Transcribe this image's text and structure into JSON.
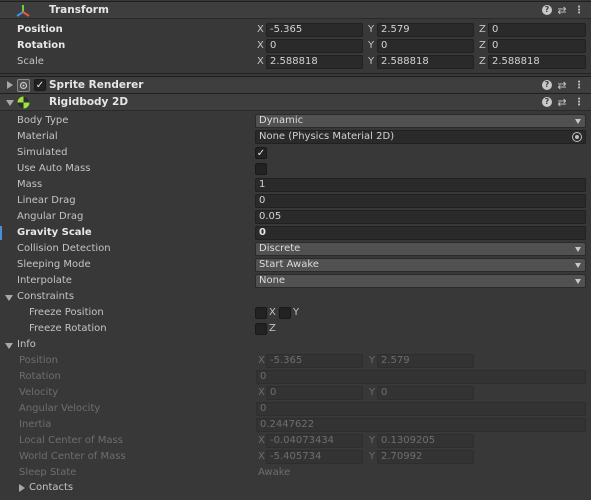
{
  "transform": {
    "title": "Transform",
    "position": {
      "label": "Position",
      "x": "-5.365",
      "y": "2.579",
      "z": "0"
    },
    "rotation": {
      "label": "Rotation",
      "x": "0",
      "y": "0",
      "z": "0"
    },
    "scale": {
      "label": "Scale",
      "x": "2.588818",
      "y": "2.588818",
      "z": "2.588818"
    }
  },
  "sprite_renderer": {
    "title": "Sprite Renderer",
    "enabled": true
  },
  "rigidbody": {
    "title": "Rigidbody 2D",
    "body_type": {
      "label": "Body Type",
      "value": "Dynamic"
    },
    "material": {
      "label": "Material",
      "value": "None (Physics Material 2D)"
    },
    "simulated": {
      "label": "Simulated",
      "checked": true
    },
    "use_auto_mass": {
      "label": "Use Auto Mass",
      "checked": false
    },
    "mass": {
      "label": "Mass",
      "value": "1"
    },
    "linear_drag": {
      "label": "Linear Drag",
      "value": "0"
    },
    "angular_drag": {
      "label": "Angular Drag",
      "value": "0.05"
    },
    "gravity_scale": {
      "label": "Gravity Scale",
      "value": "0"
    },
    "collision_detection": {
      "label": "Collision Detection",
      "value": "Discrete"
    },
    "sleeping_mode": {
      "label": "Sleeping Mode",
      "value": "Start Awake"
    },
    "interpolate": {
      "label": "Interpolate",
      "value": "None"
    },
    "constraints": {
      "label": "Constraints",
      "freeze_position": {
        "label": "Freeze Position",
        "x": "X",
        "y": "Y"
      },
      "freeze_rotation": {
        "label": "Freeze Rotation",
        "z": "Z"
      }
    },
    "info": {
      "label": "Info",
      "position": {
        "label": "Position",
        "x": "-5.365",
        "y": "2.579"
      },
      "rotation": {
        "label": "Rotation",
        "value": "0"
      },
      "velocity": {
        "label": "Velocity",
        "x": "0",
        "y": "0"
      },
      "angular_velocity": {
        "label": "Angular Velocity",
        "value": "0"
      },
      "inertia": {
        "label": "Inertia",
        "value": "0.2447622"
      },
      "local_center_of_mass": {
        "label": "Local Center of Mass",
        "x": "-0.04073434",
        "y": "0.1309205"
      },
      "world_center_of_mass": {
        "label": "World Center of Mass",
        "x": "-5.405734",
        "y": "2.70992"
      },
      "sleep_state": {
        "label": "Sleep State",
        "value": "Awake"
      },
      "contacts": {
        "label": "Contacts"
      }
    }
  },
  "axis_labels": {
    "x": "X",
    "y": "Y",
    "z": "Z"
  },
  "icons": {
    "transform": "transform-axes-icon",
    "sprite_renderer": "sprite-renderer-icon",
    "rigidbody": "rigidbody-2d-icon",
    "help": "help-icon",
    "presets": "presets-icon",
    "menu": "kebab-menu-icon",
    "checkmark": "checkmark-icon",
    "object_picker": "object-picker-icon"
  },
  "colors": {
    "background": "#383838",
    "header": "#3e3e3e",
    "field": "#2a2a2a",
    "dropdown": "#515151",
    "modified_marker": "#4a8fd8"
  }
}
